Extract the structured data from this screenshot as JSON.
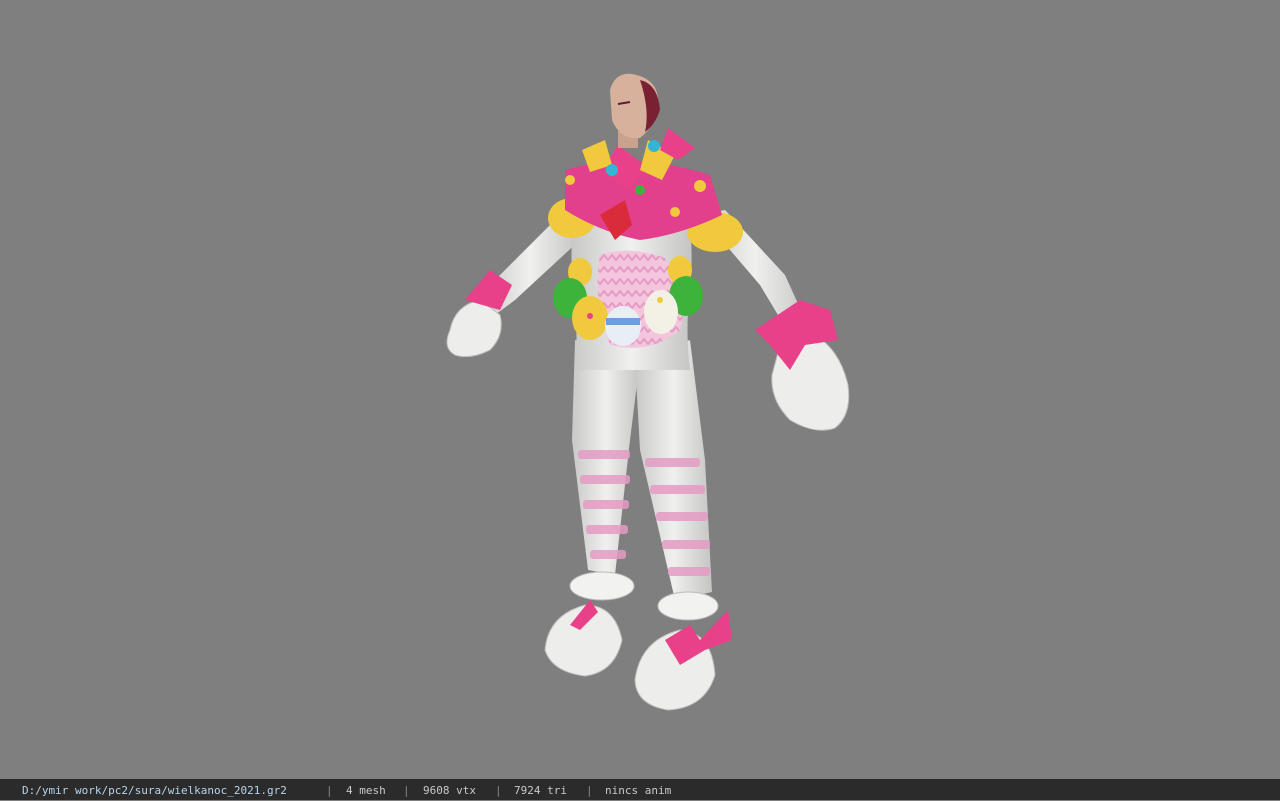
{
  "status": {
    "path": "D:/ymir work/pc2/sura/wielkanoc_2021.gr2",
    "mesh": "4 mesh",
    "vtx": "9608 vtx",
    "tri": "7924 tri",
    "anim": "nincs anim",
    "separator": "|"
  },
  "colors": {
    "background": "#7f7f7f",
    "statusbar": "#2b2b2b",
    "suit": "#e2e2e0",
    "pink": "#e8418a",
    "yellow": "#f0c93c",
    "green": "#3cb43c"
  }
}
